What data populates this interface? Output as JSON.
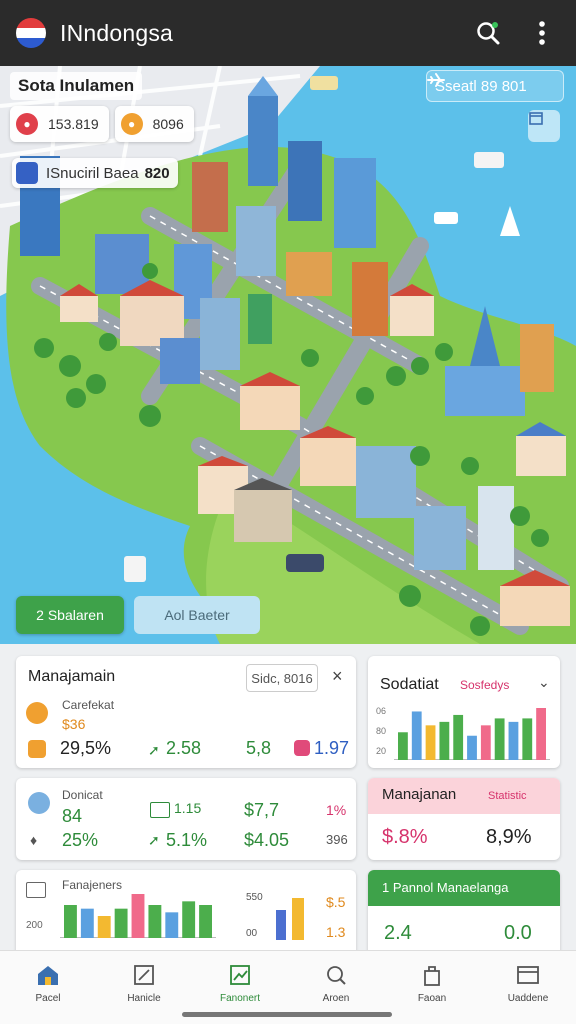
{
  "app": {
    "title": "INndongsa"
  },
  "map": {
    "title": "Sota Inulamen",
    "stat_chips": [
      {
        "icon": "pin-icon",
        "value": "153.819",
        "color": "#e0404b"
      },
      {
        "icon": "coin-icon",
        "value": "8096",
        "color": "#f0a030"
      }
    ],
    "search_chip": {
      "label": "ISnuciril Baea",
      "value": "820"
    },
    "search_box": {
      "label": "Sseatl 89 801"
    },
    "buttons": {
      "primary": "2 Sbalaren",
      "secondary": "Aol Baeter"
    }
  },
  "cards": {
    "management": {
      "title": "Manajamain",
      "filter": "Sidc, 8016",
      "subtitle": "Carefekat",
      "subvalue": "$36",
      "stats": [
        {
          "value": "29,5%",
          "color": "#222222"
        },
        {
          "value": "2.58",
          "color": "#2e8b3a"
        },
        {
          "value": "5,8",
          "color": "#2e8b3a"
        },
        {
          "value": "1.97",
          "color": "#2f5fc2"
        }
      ]
    },
    "sodatiat": {
      "title": "Sodatiat",
      "badge": "Sosfedys",
      "axis_labels": [
        "06",
        "80",
        "20"
      ],
      "chart_bar_values": [
        8,
        14,
        10,
        11,
        13,
        7,
        10,
        12,
        11,
        12,
        15
      ]
    },
    "donicat": {
      "title": "Donicat",
      "row1": [
        "84",
        "1.15",
        "$7,7",
        "1%"
      ],
      "row2": [
        "25%",
        "5.1%",
        "$4.05",
        "396"
      ]
    },
    "manajanan": {
      "title": "Manajanan",
      "badge": "Statistic",
      "values": [
        "$.8%",
        "8,9%"
      ]
    },
    "fanajeners": {
      "title": "Fanajeners",
      "axis_label": "200",
      "axis_side": [
        "550",
        "00"
      ],
      "side_values": [
        "$.5",
        "1.3"
      ],
      "chart_bar_values": [
        9,
        8,
        6,
        8,
        12,
        9,
        7,
        10,
        9
      ]
    },
    "pannol": {
      "title": "1 Pannol Manaelanga",
      "values": [
        "2.4",
        "0.0"
      ]
    }
  },
  "bottom_nav": [
    {
      "label": "Pacel",
      "icon": "home-icon"
    },
    {
      "label": "Hanicle",
      "icon": "edit-icon"
    },
    {
      "label": "Fanonert",
      "icon": "chart-icon",
      "active": true
    },
    {
      "label": "Aroen",
      "icon": "search-icon"
    },
    {
      "label": "Faoan",
      "icon": "bag-icon"
    },
    {
      "label": "Uaddene",
      "icon": "window-icon"
    }
  ]
}
